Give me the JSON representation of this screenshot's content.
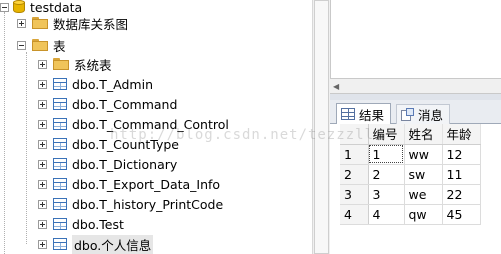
{
  "tree": {
    "database": "testdata",
    "diagrams_folder": "数据库关系图",
    "tables_folder": "表",
    "system_tables_folder": "系统表",
    "tables": [
      "dbo.T_Admin",
      "dbo.T_Command",
      "dbo.T_Command_Control",
      "dbo.T_CountType",
      "dbo.T_Dictionary",
      "dbo.T_Export_Data_Info",
      "dbo.T_history_PrintCode",
      "dbo.Test",
      "dbo.个人信息"
    ]
  },
  "tabs": {
    "results": "结果",
    "messages": "消息"
  },
  "grid": {
    "columns": [
      "编号",
      "姓名",
      "年龄"
    ],
    "rows": [
      {
        "n": "1",
        "id": "1",
        "name": "ww",
        "age": "12"
      },
      {
        "n": "2",
        "id": "2",
        "name": "sw",
        "age": "11"
      },
      {
        "n": "3",
        "id": "3",
        "name": "we",
        "age": "22"
      },
      {
        "n": "4",
        "id": "4",
        "name": "qw",
        "age": "45"
      }
    ]
  },
  "watermark": "http://blog.csdn.net/tezzzll",
  "icons": {
    "database": "database-icon",
    "folder": "folder-icon",
    "table": "table-icon",
    "results_tab": "grid-icon",
    "messages_tab": "message-icon"
  }
}
